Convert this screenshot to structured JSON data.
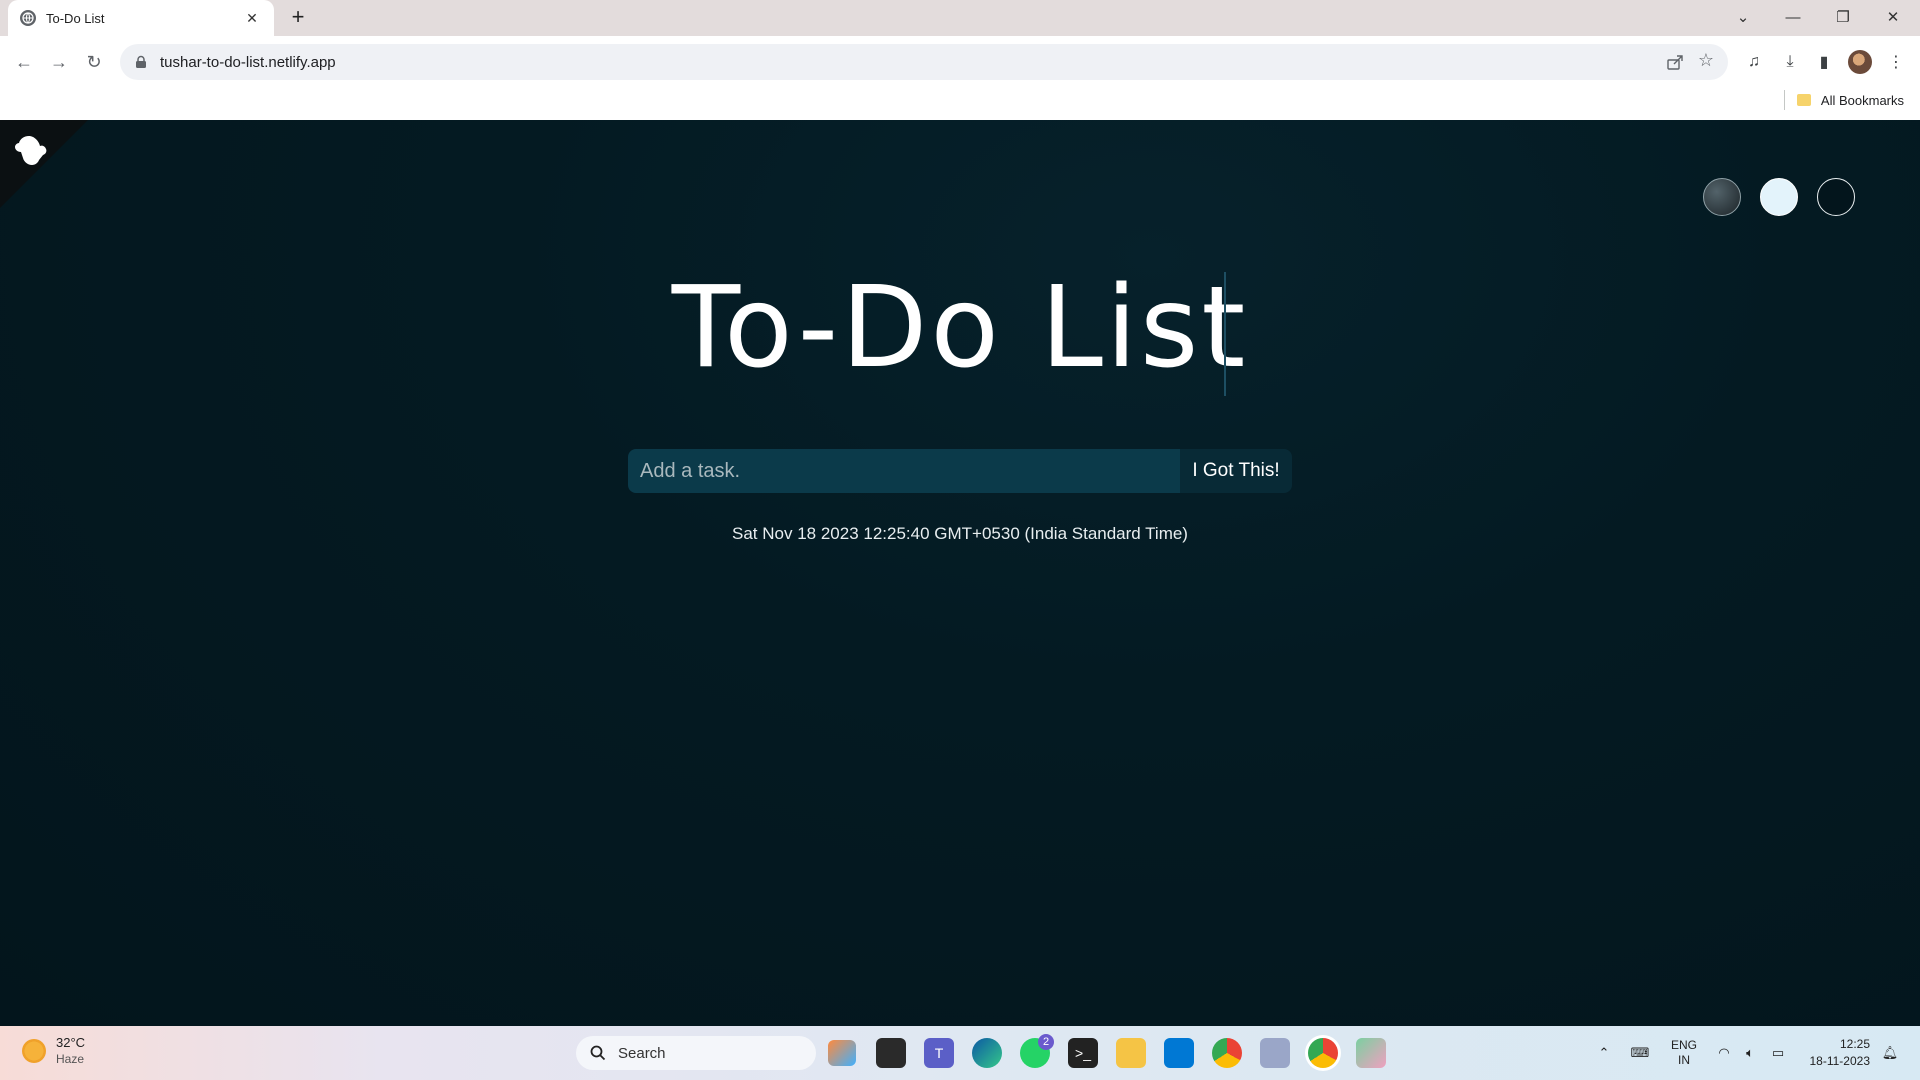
{
  "browser": {
    "tab_title": "To-Do List",
    "new_tab_label": "+",
    "url": "tushar-to-do-list.netlify.app",
    "bookmarks_label": "All Bookmarks"
  },
  "page": {
    "heading": "To-Do List",
    "task_input_placeholder": "Add a task.",
    "submit_label": "I Got This!",
    "datetime": "Sat Nov 18 2023 12:25:40 GMT+0530 (India Standard Time)",
    "theme_options": [
      "standard",
      "light",
      "darker"
    ]
  },
  "taskbar": {
    "weather_temp": "32°C",
    "weather_condition": "Haze",
    "search_label": "Search",
    "whatsapp_badge": "2",
    "language_top": "ENG",
    "language_bottom": "IN",
    "time": "12:25",
    "date": "18-11-2023"
  },
  "colors": {
    "page_bg": "#041a22",
    "input_bg": "#0b3a4a",
    "button_bg": "#082a36",
    "heading_text": "#ffffff"
  }
}
